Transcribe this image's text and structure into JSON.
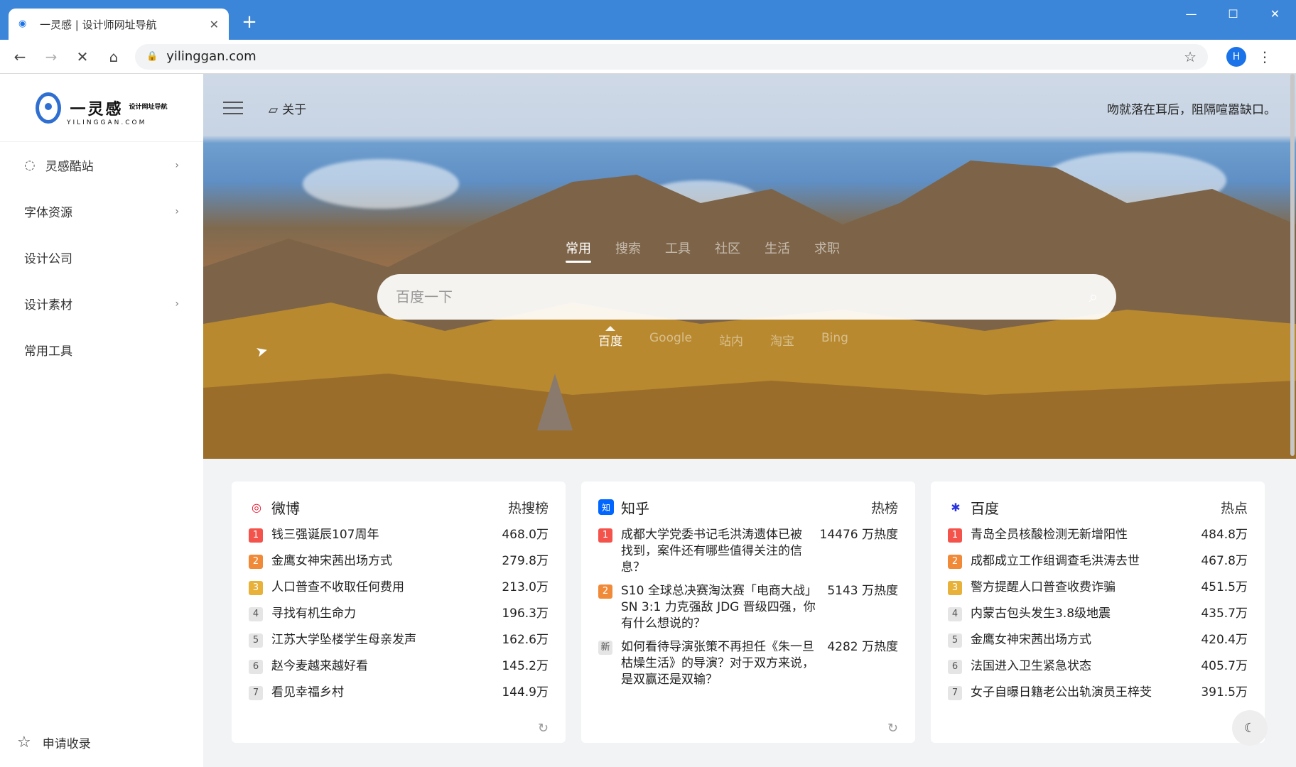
{
  "browser": {
    "tab_title": "一灵感 | 设计师网址导航",
    "tab_close": "✕",
    "new_tab": "+",
    "url": "yilinggan.com",
    "profile_initial": "H"
  },
  "sidebar": {
    "logo_text": "一灵感",
    "logo_sub": "设计网址导航",
    "logo_en": "YILINGGAN.COM",
    "items": [
      {
        "label": "灵感酷站"
      },
      {
        "label": "字体资源"
      },
      {
        "label": "设计公司"
      },
      {
        "label": "设计素材"
      },
      {
        "label": "常用工具"
      }
    ],
    "apply_label": "申请收录"
  },
  "header": {
    "about": "关于",
    "quote": "吻就落在耳后，阻隔喧嚣缺口。"
  },
  "search": {
    "tabs": [
      "常用",
      "搜索",
      "工具",
      "社区",
      "生活",
      "求职"
    ],
    "placeholder": "百度一下",
    "engines": [
      "百度",
      "Google",
      "站内",
      "淘宝",
      "Bing"
    ]
  },
  "cards": [
    {
      "title": "微博",
      "tag": "热搜榜",
      "rows": [
        {
          "rank": "1",
          "text": "钱三强诞辰107周年",
          "value": "468.0万"
        },
        {
          "rank": "2",
          "text": "金鹰女神宋茜出场方式",
          "value": "279.8万"
        },
        {
          "rank": "3",
          "text": "人口普查不收取任何费用",
          "value": "213.0万"
        },
        {
          "rank": "4",
          "text": "寻找有机生命力",
          "value": "196.3万"
        },
        {
          "rank": "5",
          "text": "江苏大学坠楼学生母亲发声",
          "value": "162.6万"
        },
        {
          "rank": "6",
          "text": "赵今麦越来越好看",
          "value": "145.2万"
        },
        {
          "rank": "7",
          "text": "看见幸福乡村",
          "value": "144.9万"
        }
      ]
    },
    {
      "title": "知乎",
      "tag": "热榜",
      "rows": [
        {
          "rank": "1",
          "text": "成都大学党委书记毛洪涛遗体已被找到，案件还有哪些值得关注的信息？",
          "value": "14476 万热度"
        },
        {
          "rank": "2",
          "text": "S10 全球总决赛淘汰赛「电商大战」SN 3:1 力克强敌 JDG 晋级四强，你有什么想说的？",
          "value": "5143 万热度"
        },
        {
          "rank": "新",
          "text": "如何看待导演张策不再担任《朱一旦枯燥生活》的导演？对于双方来说，是双赢还是双输？",
          "value": "4282 万热度"
        }
      ]
    },
    {
      "title": "百度",
      "tag": "热点",
      "rows": [
        {
          "rank": "1",
          "text": "青岛全员核酸检测无新增阳性",
          "value": "484.8万"
        },
        {
          "rank": "2",
          "text": "成都成立工作组调查毛洪涛去世",
          "value": "467.8万"
        },
        {
          "rank": "3",
          "text": "警方提醒人口普查收费诈骗",
          "value": "451.5万"
        },
        {
          "rank": "4",
          "text": "内蒙古包头发生3.8级地震",
          "value": "435.7万"
        },
        {
          "rank": "5",
          "text": "金鹰女神宋茜出场方式",
          "value": "420.4万"
        },
        {
          "rank": "6",
          "text": "法国进入卫生紧急状态",
          "value": "405.7万"
        },
        {
          "rank": "7",
          "text": "女子自曝日籍老公出轨演员王梓芠",
          "value": "391.5万"
        }
      ]
    }
  ]
}
